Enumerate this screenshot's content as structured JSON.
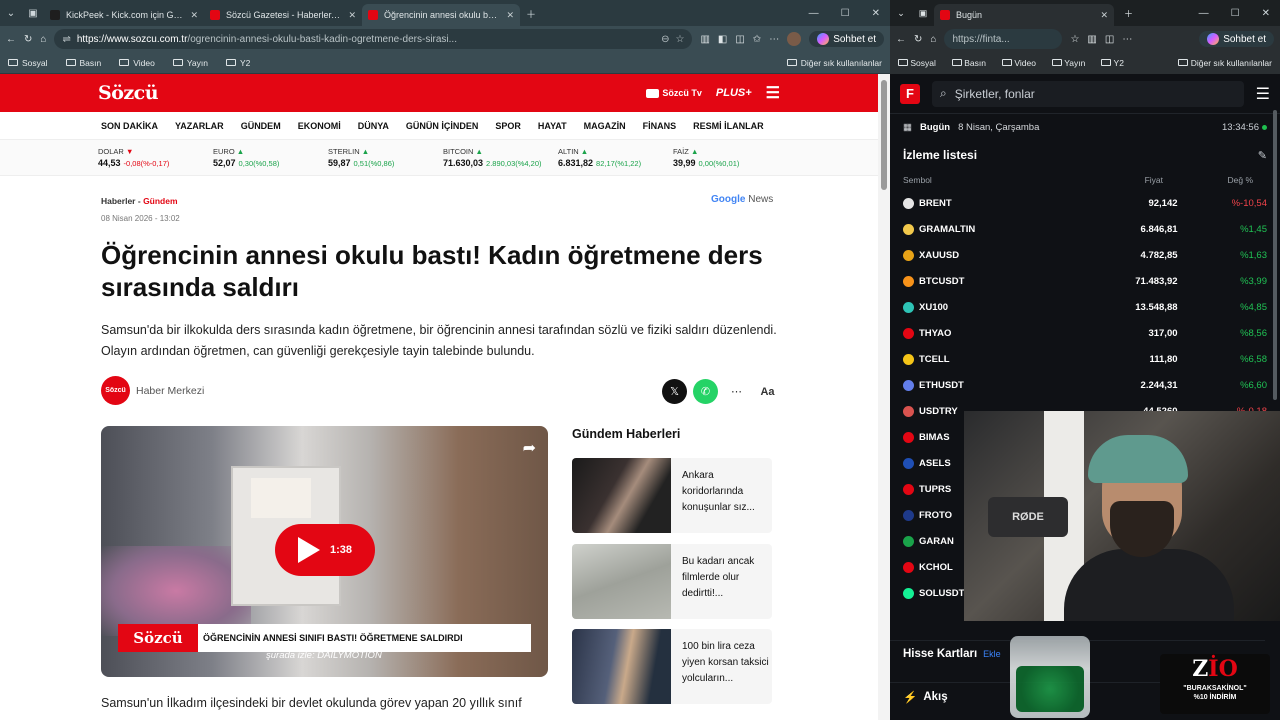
{
  "left_window": {
    "tabs": [
      {
        "title": "KickPeek - Kick.com için Gerçek Za",
        "color": "#1e1e1e",
        "active": false
      },
      {
        "title": "Sözcü Gazetesi - Haberler, son dak",
        "color": "#e30613",
        "active": false
      },
      {
        "title": "Öğrencinin annesi okulu bastı! Kad",
        "color": "#e30613",
        "active": true
      }
    ],
    "url_host": "https://www.sozcu.com.tr",
    "url_path": "/ogrencinin-annesi-okulu-basti-kadin-ogretmene-ders-sirasi...",
    "copilot_label": "Sohbet et",
    "bookmarks": [
      "Sosyal",
      "Basın",
      "Video",
      "Yayın",
      "Y2"
    ],
    "bookmarks_other": "Diğer sık kullanılanlar"
  },
  "site": {
    "logo": "Sözcü",
    "tv_label": "Sözcü Tv",
    "plus_label": "PLUS+",
    "nav": [
      "SON DAKİKA",
      "YAZARLAR",
      "GÜNDEM",
      "EKONOMİ",
      "DÜNYA",
      "GÜNÜN İÇİNDEN",
      "SPOR",
      "HAYAT",
      "MAGAZİN",
      "FİNANS",
      "RESMİ İLANLAR"
    ],
    "ticker": [
      {
        "name": "DOLAR",
        "dir": "down",
        "value": "44,53",
        "change": "-0,08(%-0,17)"
      },
      {
        "name": "EURO",
        "dir": "up",
        "value": "52,07",
        "change": "0,30(%0,58)"
      },
      {
        "name": "STERLIN",
        "dir": "up",
        "value": "59,87",
        "change": "0,51(%0,86)"
      },
      {
        "name": "BITCOIN",
        "dir": "up",
        "value": "71.630,03",
        "change": "2.890,03(%4,20)"
      },
      {
        "name": "ALTIN",
        "dir": "up",
        "value": "6.831,82",
        "change": "82,17(%1,22)"
      },
      {
        "name": "FAİZ",
        "dir": "up",
        "value": "39,99",
        "change": "0,00(%0,01)"
      }
    ]
  },
  "article": {
    "crumb_a": "Haberler",
    "crumb_sep": " - ",
    "crumb_b": "Gündem",
    "date": "08 Nisan 2026 - 13:02",
    "gnews_g": "Google",
    "gnews_n": " News",
    "title": "Öğrencinin annesi okulu bastı! Kadın öğretmene ders sırasında saldırı",
    "lead": "Samsun'da bir ilkokulda ders sırasında kadın öğretmene, bir öğrencinin annesi tarafından sözlü ve fiziki saldırı düzenlendi. Olayın ardından öğretmen, can güvenliği gerekçesiyle tayin talebinde bulundu.",
    "author_avatar": "Sözcü",
    "author": "Haber Merkezi",
    "video_duration": "1:38",
    "video_caption_logo": "Sözcü",
    "video_caption": "ÖĞRENCİNİN ANNESİ SINIFI BASTI! ÖĞRETMENE SALDIRDI",
    "video_source": "şurada izle: DAILYMOTION",
    "first_para": "Samsun'un İlkadım ilçesindeki bir devlet okulunda görev yapan 20 yıllık sınıf"
  },
  "sidebar": {
    "heading": "Gündem Haberleri",
    "cards": [
      {
        "text": "Ankara koridorlarında konuşunlar sız..."
      },
      {
        "text": "Bu kadarı ancak filmlerde olur dedirtti!..."
      },
      {
        "text": "100 bin lira ceza yiyen korsan taksici yolcuların..."
      }
    ]
  },
  "right_window": {
    "tab_title": "Bugün",
    "url": "https://finta...",
    "copilot_label": "Sohbet et",
    "bookmarks": [
      "Sosyal",
      "Basın",
      "Video",
      "Yayın",
      "Y2"
    ],
    "bookmarks_other": "Diğer sık kullanılanlar",
    "search_placeholder": "Şirketler, fonlar",
    "today_label": "Bugün",
    "today_date": "8 Nisan, Çarşamba",
    "time": "13:34:56",
    "watchlist_title": "İzleme listesi",
    "col_symbol": "Sembol",
    "col_price": "Fiyat",
    "col_change": "Değ %",
    "rows": [
      {
        "sym": "BRENT",
        "price": "92,142",
        "chg": "%-10,54",
        "dir": "down",
        "color": "#e5e5e5"
      },
      {
        "sym": "GRAMALTIN",
        "price": "6.846,81",
        "chg": "%1,45",
        "dir": "up",
        "color": "#f2c94c"
      },
      {
        "sym": "XAUUSD",
        "price": "4.782,85",
        "chg": "%1,63",
        "dir": "up",
        "color": "#e8a317"
      },
      {
        "sym": "BTCUSDT",
        "price": "71.483,92",
        "chg": "%3,99",
        "dir": "up",
        "color": "#f7931a"
      },
      {
        "sym": "XU100",
        "price": "13.548,88",
        "chg": "%4,85",
        "dir": "up",
        "color": "#2ec4b6"
      },
      {
        "sym": "THYAO",
        "price": "317,00",
        "chg": "%8,56",
        "dir": "up",
        "color": "#e30613"
      },
      {
        "sym": "TCELL",
        "price": "111,80",
        "chg": "%6,58",
        "dir": "up",
        "color": "#f5c518"
      },
      {
        "sym": "ETHUSDT",
        "price": "2.244,31",
        "chg": "%6,60",
        "dir": "up",
        "color": "#627eea"
      },
      {
        "sym": "USDTRY",
        "price": "44,5260",
        "chg": "%-0,18",
        "dir": "down",
        "color": "#d9534f"
      },
      {
        "sym": "BIMAS",
        "price": "",
        "chg": "",
        "dir": "up",
        "color": "#e30613"
      },
      {
        "sym": "ASELS",
        "price": "",
        "chg": "",
        "dir": "up",
        "color": "#1f4fb5"
      },
      {
        "sym": "TUPRS",
        "price": "",
        "chg": "",
        "dir": "up",
        "color": "#e30613"
      },
      {
        "sym": "FROTO",
        "price": "",
        "chg": "",
        "dir": "up",
        "color": "#1e3a8a"
      },
      {
        "sym": "GARAN",
        "price": "",
        "chg": "",
        "dir": "up",
        "color": "#1aa34a"
      },
      {
        "sym": "KCHOL",
        "price": "",
        "chg": "",
        "dir": "up",
        "color": "#e30613"
      },
      {
        "sym": "SOLUSDT",
        "price": "",
        "chg": "",
        "dir": "up",
        "color": "#14f195"
      }
    ],
    "cards_title": "Hisse Kartları",
    "cards_add": "Ekle",
    "flow_title": "Akış"
  },
  "overlay": {
    "mic_label": "RØDE",
    "promo_logo_a": "Z",
    "promo_logo_b": "İO",
    "promo_code": "\"BURAKSAKİNOL\"",
    "promo_discount": "%10 İNDİRİM"
  }
}
